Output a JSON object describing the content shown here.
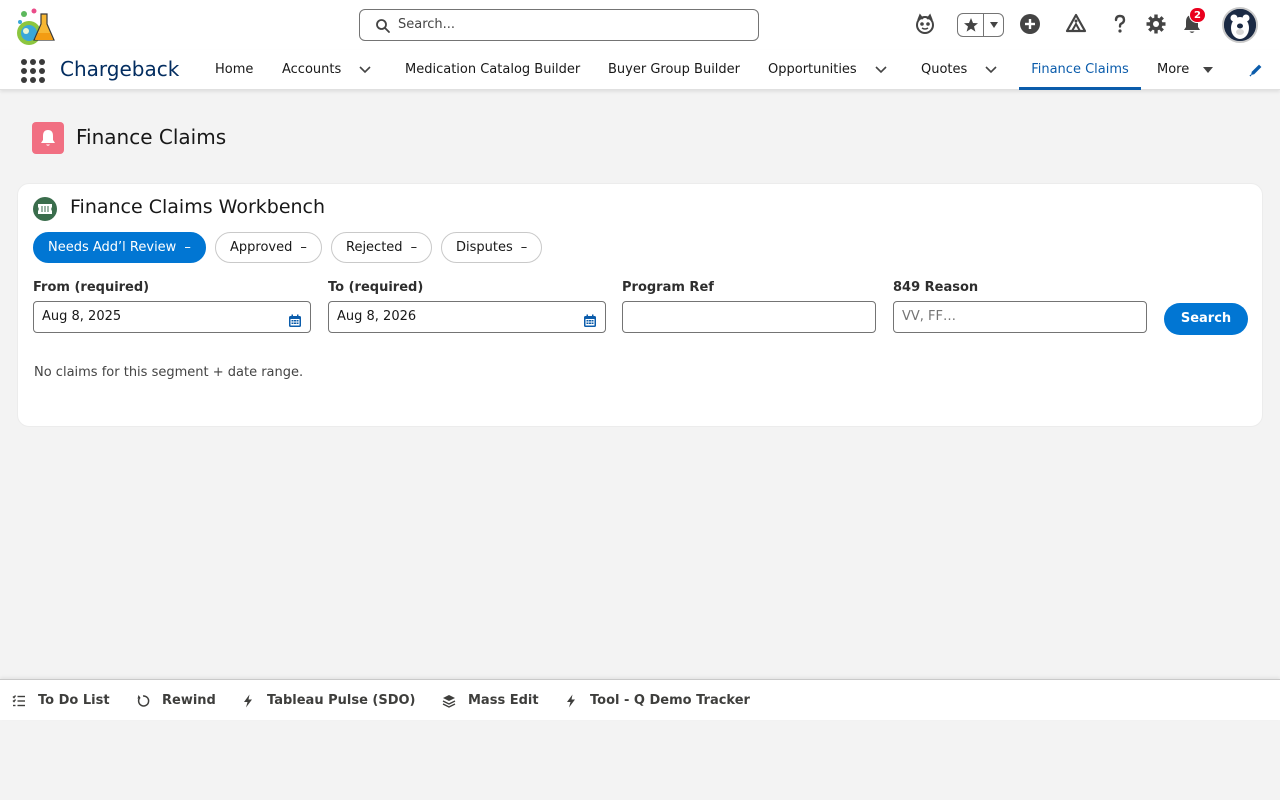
{
  "header": {
    "search_placeholder": "Search...",
    "notification_count": "2",
    "icons": [
      "astro-icon",
      "favorites-star-icon",
      "favorites-dropdown-icon",
      "add-icon",
      "trailhead-icon",
      "help-icon",
      "setup-gear-icon",
      "notification-bell-icon",
      "user-avatar"
    ]
  },
  "nav": {
    "app_name": "Chargeback",
    "items": [
      {
        "label": "Home"
      },
      {
        "label": "Accounts"
      },
      {
        "label": "Medication Catalog Builder"
      },
      {
        "label": "Buyer Group Builder"
      },
      {
        "label": "Opportunities"
      },
      {
        "label": "Quotes"
      },
      {
        "label": "Finance Claims"
      },
      {
        "label": "More"
      }
    ],
    "active": "Finance Claims"
  },
  "page": {
    "title": "Finance Claims"
  },
  "workbench": {
    "title": "Finance Claims Workbench",
    "segments": [
      {
        "label": "Needs Add’l Review",
        "count": "–"
      },
      {
        "label": "Approved",
        "count": "–"
      },
      {
        "label": "Rejected",
        "count": "–"
      },
      {
        "label": "Disputes",
        "count": "–"
      }
    ],
    "selected_segment": "Needs Add’l Review",
    "filters": {
      "from_label": "From (required)",
      "from_value": "Aug 8, 2025",
      "to_label": "To (required)",
      "to_value": "Aug 8, 2026",
      "program_ref_label": "Program Ref",
      "program_ref_value": "",
      "reason_label": "849 Reason",
      "reason_placeholder": "VV, FF…"
    },
    "search_label": "Search",
    "empty_message": "No claims for this segment + date range."
  },
  "utility_bar": {
    "items": [
      {
        "label": "To Do List",
        "icon": "checklist-icon"
      },
      {
        "label": "Rewind",
        "icon": "rewind-icon"
      },
      {
        "label": "Tableau Pulse (SDO)",
        "icon": "lightning-icon"
      },
      {
        "label": "Mass Edit",
        "icon": "layers-icon"
      },
      {
        "label": "Tool - Q Demo Tracker",
        "icon": "lightning-icon"
      }
    ]
  },
  "colors": {
    "brand": "#0176d3",
    "active_tab": "#0b5cab",
    "app_name": "#032d60",
    "page_icon_bg": "#f16f82",
    "card_icon_bg": "#3a6d4c",
    "badge": "#ea001e"
  }
}
